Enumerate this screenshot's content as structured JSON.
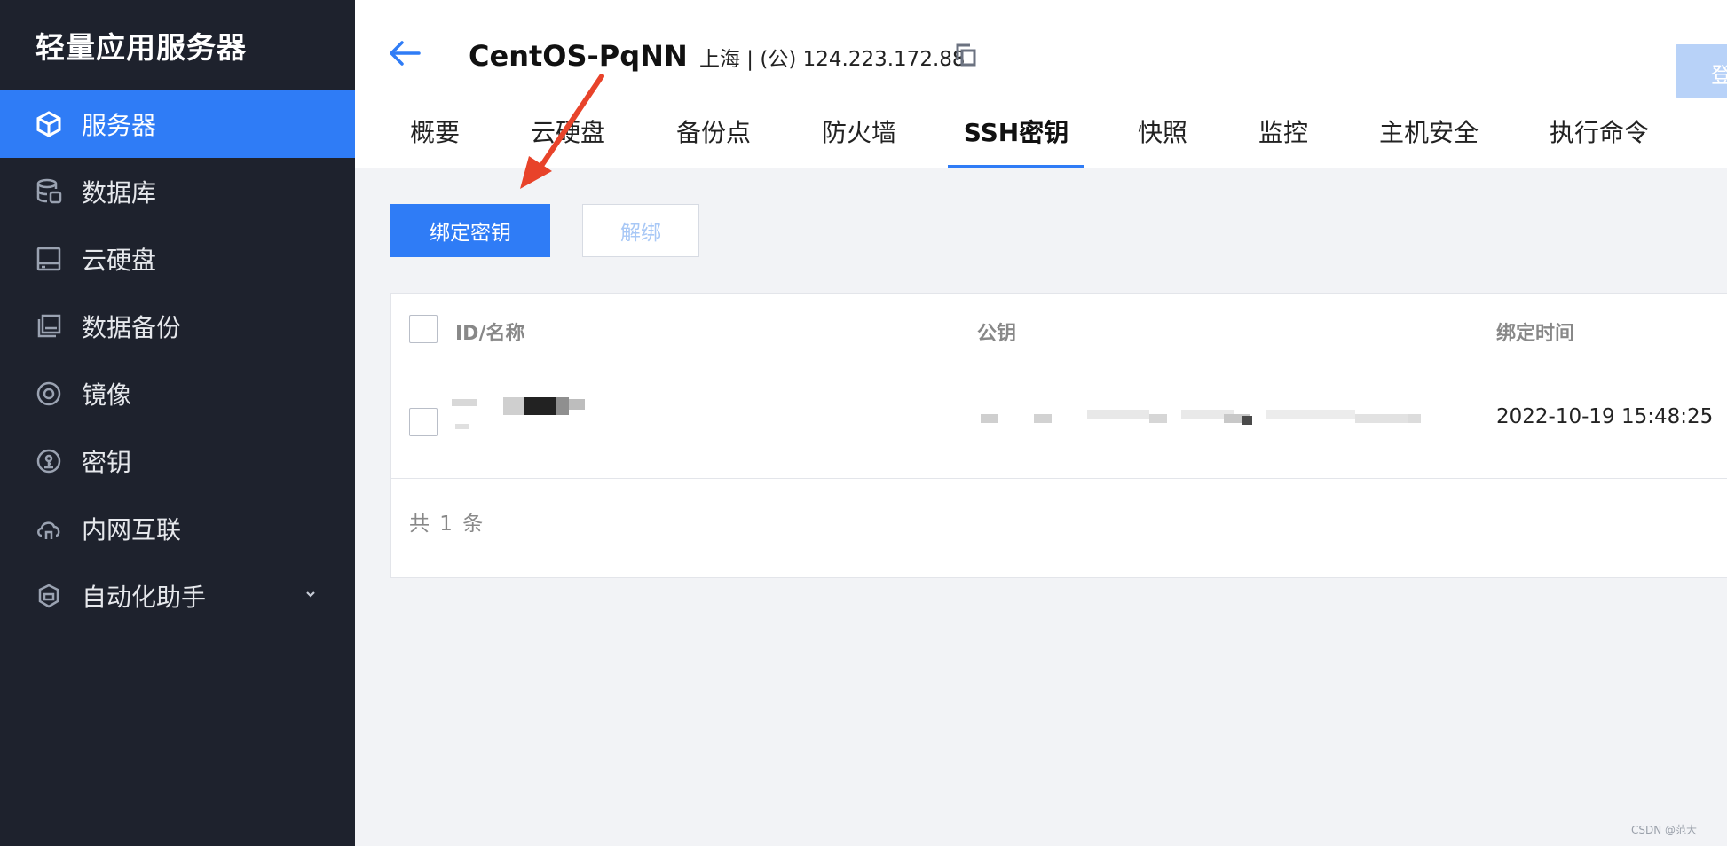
{
  "sidebar": {
    "title": "轻量应用服务器",
    "items": [
      {
        "label": "服务器",
        "icon": "cube-icon",
        "active": true
      },
      {
        "label": "数据库",
        "icon": "database-icon",
        "active": false
      },
      {
        "label": "云硬盘",
        "icon": "disk-icon",
        "active": false
      },
      {
        "label": "数据备份",
        "icon": "backup-icon",
        "active": false
      },
      {
        "label": "镜像",
        "icon": "image-icon",
        "active": false
      },
      {
        "label": "密钥",
        "icon": "key-icon",
        "active": false
      },
      {
        "label": "内网互联",
        "icon": "cloud-link-icon",
        "active": false
      },
      {
        "label": "自动化助手",
        "icon": "automation-icon",
        "active": false,
        "expandable": true
      }
    ]
  },
  "header": {
    "instance_name": "CentOS-PqNN",
    "instance_ip": "上海 | (公) 124.223.172.88",
    "login_button_label": "登",
    "tabs": [
      "概要",
      "云硬盘",
      "备份点",
      "防火墙",
      "SSH密钥",
      "快照",
      "监控",
      "主机安全",
      "执行命令"
    ],
    "active_tab": "SSH密钥"
  },
  "toolbar": {
    "bind_key_label": "绑定密钥",
    "unbind_label": "解绑"
  },
  "table": {
    "columns": [
      "ID/名称",
      "公钥",
      "绑定时间"
    ],
    "rows": [
      {
        "bound_time": "2022-10-19 15:48:25"
      }
    ],
    "total_text": "共 1 条"
  },
  "watermark": "CSDN @范大",
  "colors": {
    "sidebar_bg": "#1e222d",
    "accent": "#2f7cf6",
    "annotation_arrow": "#e8432a"
  }
}
